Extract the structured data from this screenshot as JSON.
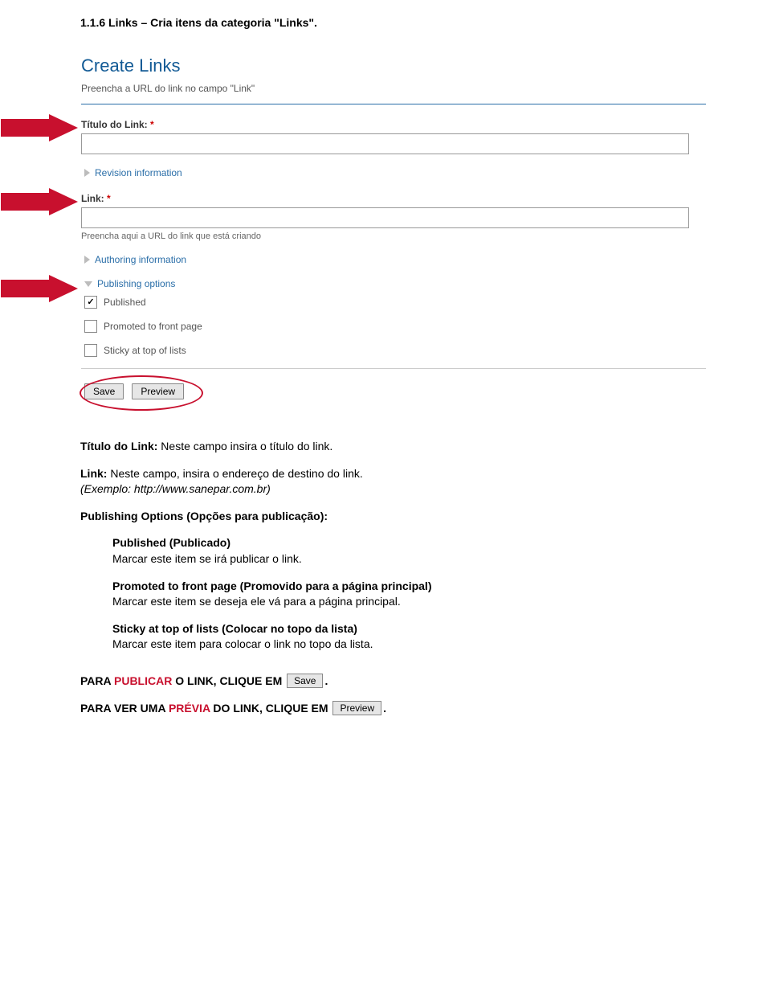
{
  "sectionTitle": "1.1.6 Links – Cria itens da categoria \"Links\".",
  "form": {
    "heading": "Create Links",
    "subheading": "Preencha a URL do link no campo \"Link\"",
    "tituloLabel": "Título do Link:",
    "revision": "Revision information",
    "linkLabel": "Link:",
    "linkHelp": "Preencha aqui a URL do link que está criando",
    "authoring": "Authoring information",
    "publishing": "Publishing options",
    "cbPublished": "Published",
    "cbPromoted": "Promoted to front page",
    "cbSticky": "Sticky at top of lists",
    "btnSave": "Save",
    "btnPreview": "Preview"
  },
  "expl": {
    "titulo_b": "Título do Link:",
    "titulo_t": " Neste campo insira o título do link.",
    "link_b": "Link:",
    "link_t1": " Neste campo, insira o endereço de destino do link.",
    "link_t2": "(Exemplo: http://www.sanepar.com.br)",
    "pubopt": "Publishing Options (Opções para publicação):",
    "pub_b": "Published (Publicado)",
    "pub_t": "Marcar este item se irá publicar o link.",
    "prom_b": "Promoted to front page (Promovido para a página principal)",
    "prom_t": "Marcar este item se deseja ele vá para a página principal.",
    "stk_b": "Sticky at top of lists (Colocar no topo da lista)",
    "stk_t": "Marcar este item para colocar o link no topo da lista.",
    "para1a": "PARA ",
    "para1b": "PUBLICAR",
    "para1c": " O LINK, CLIQUE EM ",
    "para2a": "PARA VER UMA ",
    "para2b": "PRÉVIA",
    "para2c": " DO LINK, CLIQUE EM ",
    "btnSave": "Save",
    "btnPreview": "Preview"
  }
}
